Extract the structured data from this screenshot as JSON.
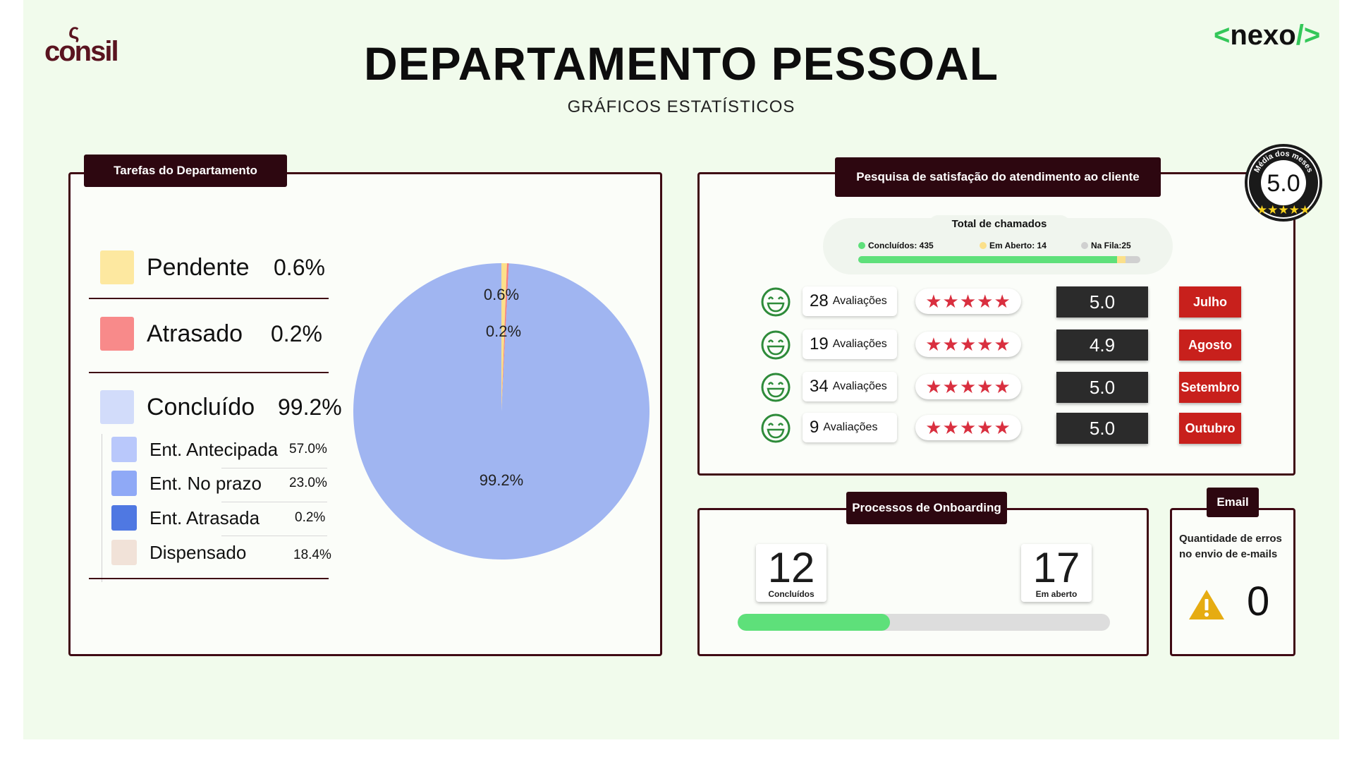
{
  "header": {
    "logo_left": "consil",
    "logo_left_mark": "ς",
    "logo_right": "nexo",
    "title": "DEPARTAMENTO PESSOAL",
    "subtitle": "GRÁFICOS ESTATÍSTICOS"
  },
  "tasks": {
    "tab": "Tarefas do Departamento",
    "legend": [
      {
        "label": "Pendente",
        "value": "0.6%",
        "color": "#fde8a0"
      },
      {
        "label": "Atrasado",
        "value": "0.2%",
        "color": "#f88a8a"
      },
      {
        "label": "Concluído",
        "value": "99.2%",
        "color": "#d2dcfa"
      }
    ],
    "sub_legend": [
      {
        "label": "Ent. Antecipada",
        "value": "57.0%",
        "color": "#b9c8fb"
      },
      {
        "label": "Ent. No prazo",
        "value": "23.0%",
        "color": "#8fa9f6"
      },
      {
        "label": "Ent. Atrasada",
        "value": "0.2%",
        "color": "#4f78e2"
      },
      {
        "label": "Dispensado",
        "value": "18.4%",
        "color": "#f1e2d8"
      }
    ]
  },
  "chart_data": {
    "type": "pie",
    "categories": [
      "Pendente",
      "Atrasado",
      "Concluído"
    ],
    "values": [
      0.6,
      0.2,
      99.2
    ],
    "labels": [
      "0.6%",
      "0.2%",
      "99.2%"
    ],
    "colors": [
      "#fde08a",
      "#f47e7e",
      "#a0b5f1"
    ]
  },
  "satisfaction": {
    "tab": "Pesquisa de satisfação do atendimento ao cliente",
    "badge": {
      "text": "Média dos meses",
      "value": "5.0"
    },
    "total": {
      "title": "Total de chamados",
      "items": [
        {
          "label": "Concluídos: 435",
          "color": "#5ee07a"
        },
        {
          "label": "Em Aberto: 14",
          "color": "#fbe08a"
        },
        {
          "label": "Na Fila:25",
          "color": "#d0d0d0"
        }
      ],
      "bar": {
        "concluidos": 435,
        "aberto": 14,
        "fila": 25
      }
    },
    "rows": [
      {
        "count": "28",
        "label": "Avaliações",
        "stars": "★★★★★",
        "score": "5.0",
        "month": "Julho"
      },
      {
        "count": "19",
        "label": "Avaliações",
        "stars": "★★★★★",
        "score": "4.9",
        "month": "Agosto"
      },
      {
        "count": "34",
        "label": "Avaliações",
        "stars": "★★★★★",
        "score": "5.0",
        "month": "Setembro"
      },
      {
        "count": "9",
        "label": "Avaliações",
        "stars": "★★★★★",
        "score": "5.0",
        "month": "Outubro"
      }
    ]
  },
  "onboarding": {
    "tab": "Processos de Onboarding",
    "concluidos": {
      "value": "12",
      "label": "Concluídos"
    },
    "aberto": {
      "value": "17",
      "label": "Em aberto"
    },
    "progress": 0.41
  },
  "email": {
    "tab": "Email",
    "description": "Quantidade de erros no envio de e-mails",
    "value": "0"
  }
}
